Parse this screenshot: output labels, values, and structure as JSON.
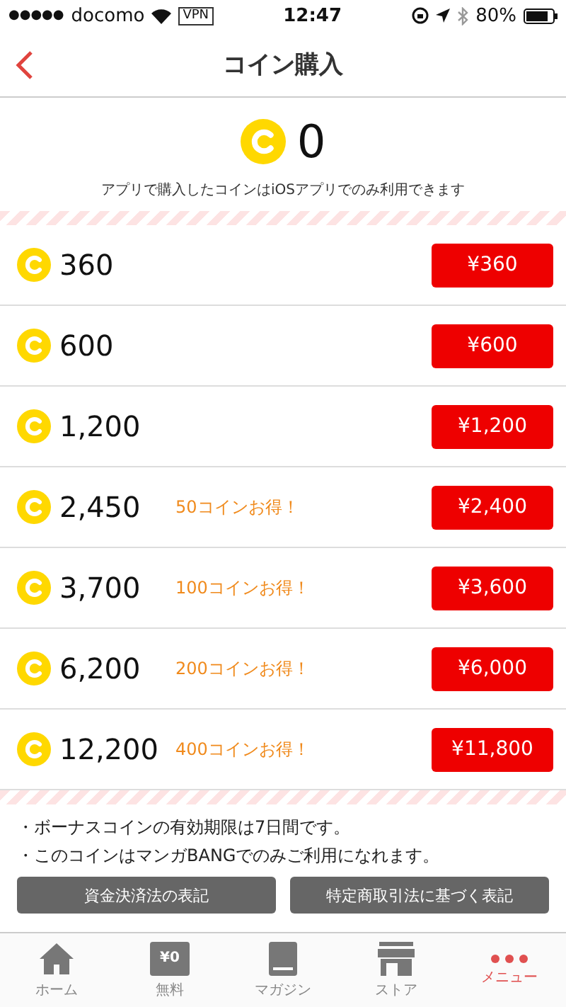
{
  "status_bar": {
    "signal": "●●●●●",
    "carrier": "docomo",
    "vpn": "VPN",
    "time": "12:47",
    "battery": "80%"
  },
  "nav": {
    "title": "コイン購入"
  },
  "balance": {
    "amount": "0",
    "note": "アプリで購入したコインはiOSアプリでのみ利用できます"
  },
  "packs": [
    {
      "coins": "360",
      "price": "¥360"
    },
    {
      "coins": "600",
      "price": "¥600"
    },
    {
      "coins": "1,200",
      "price": "¥1,200"
    },
    {
      "coins": "2,450",
      "bonus": "50コインお得！",
      "price": "¥2,400"
    },
    {
      "coins": "3,700",
      "bonus": "100コインお得！",
      "price": "¥3,600"
    },
    {
      "coins": "6,200",
      "bonus": "200コインお得！",
      "price": "¥6,000"
    },
    {
      "coins": "12,200",
      "bonus": "400コインお得！",
      "price": "¥11,800"
    }
  ],
  "notes": [
    "・ボーナスコインの有効期限は7日間です。",
    "・このコインはマンガBANGでのみご利用になれます。"
  ],
  "legal_buttons": [
    "資金決済法の表記",
    "特定商取引法に基づく表記"
  ],
  "tab_bar": [
    {
      "kind": "home",
      "label": "ホーム"
    },
    {
      "kind": "free",
      "label": "無料",
      "badge": "¥0"
    },
    {
      "kind": "magazine",
      "label": "マガジン"
    },
    {
      "kind": "store",
      "label": "ストア"
    },
    {
      "kind": "menu",
      "label": "メニュー"
    }
  ]
}
